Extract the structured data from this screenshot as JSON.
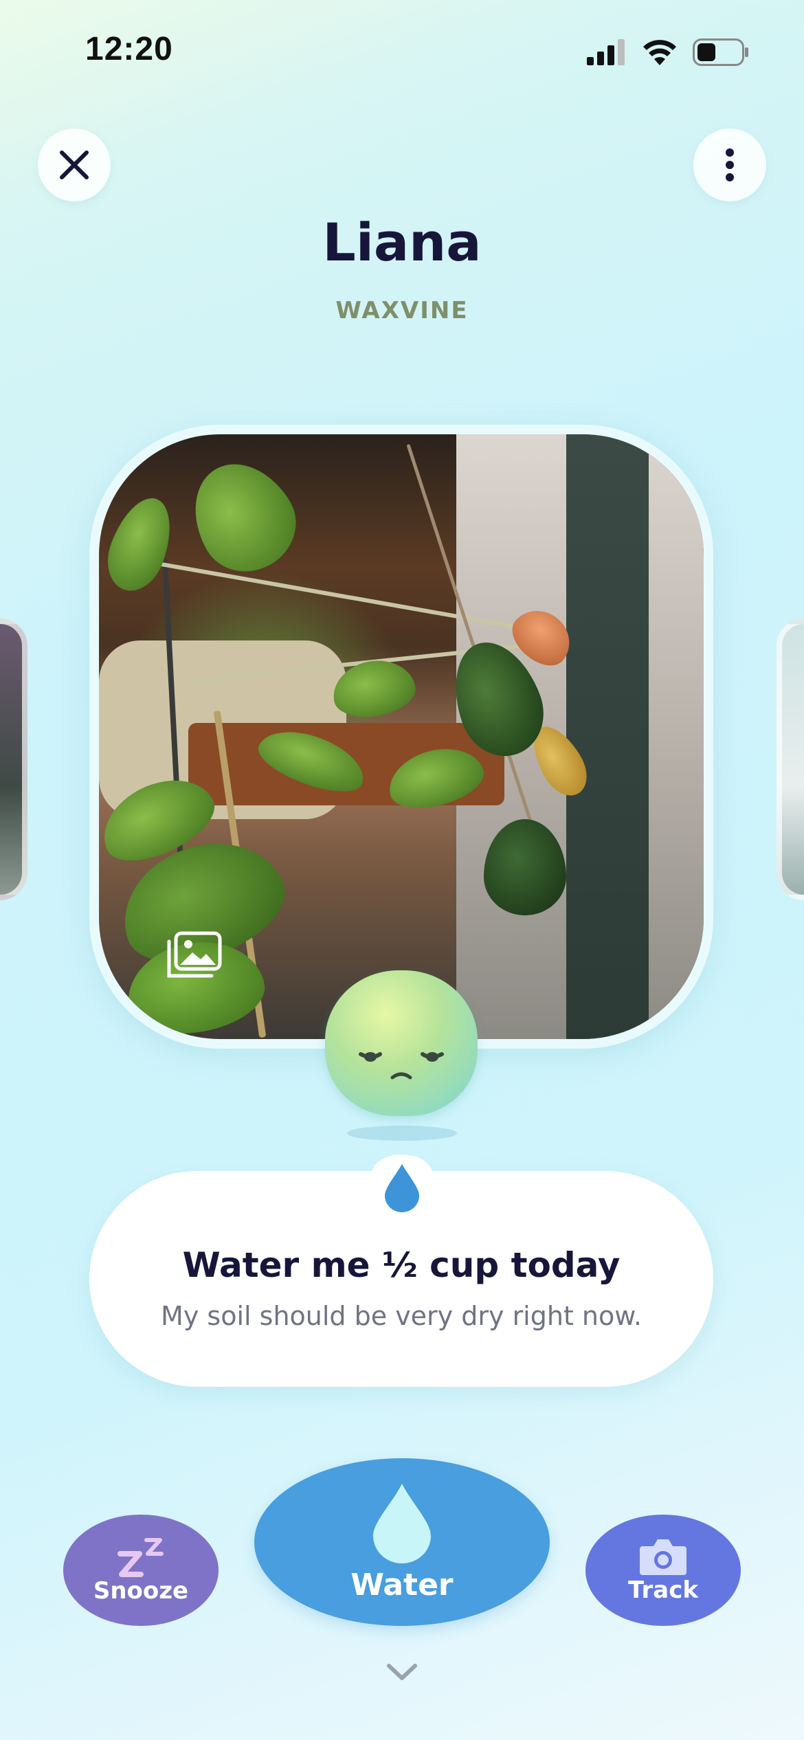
{
  "status_bar": {
    "time": "12:20"
  },
  "header": {
    "close_icon": "close-icon",
    "more_icon": "more-vertical-icon"
  },
  "plant": {
    "name": "Liana",
    "species": "WAXVINE"
  },
  "care": {
    "title": "Water me ½ cup today",
    "subtitle": "My soil should be very dry right now."
  },
  "actions": {
    "snooze_label": "Snooze",
    "water_label": "Water",
    "track_label": "Track"
  },
  "colors": {
    "snooze": "#7f73c7",
    "water": "#489ede",
    "track": "#6477e0",
    "species": "#7f8f6a"
  }
}
